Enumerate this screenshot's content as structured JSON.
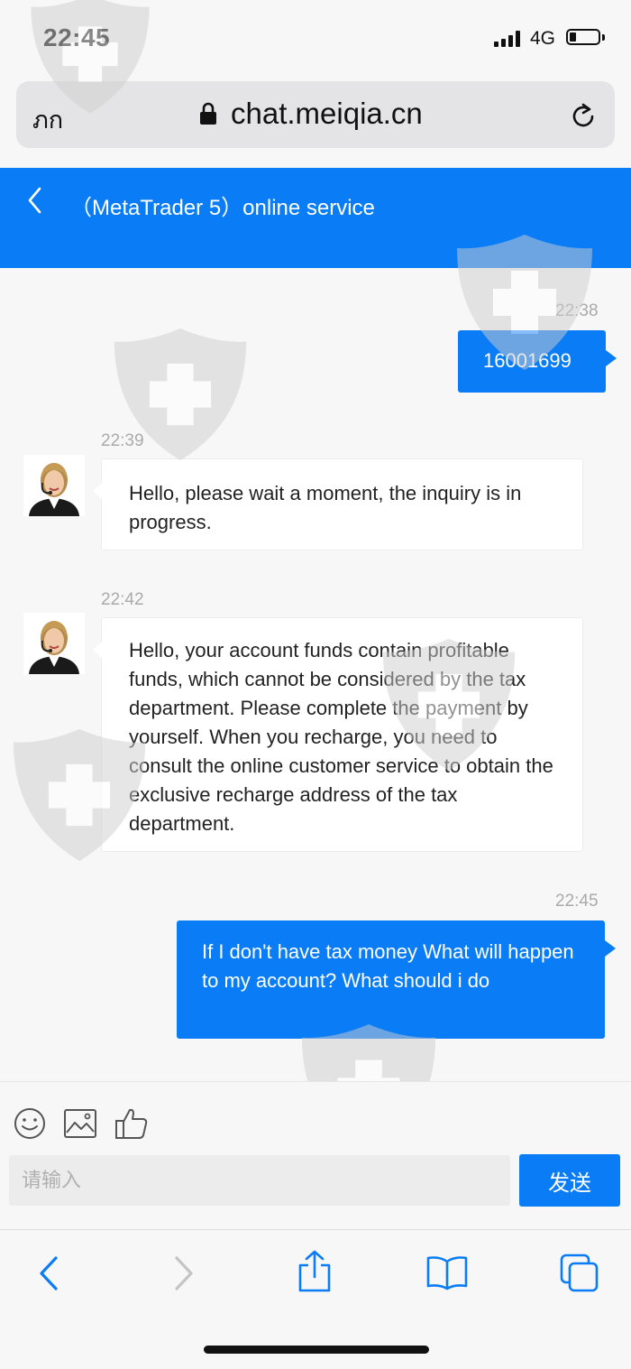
{
  "status_bar": {
    "time": "22:45",
    "network": "4G"
  },
  "browser": {
    "text_size_label": "ภก",
    "url": "chat.meiqia.cn"
  },
  "chat_header": {
    "title": "（MetaTrader 5）online service"
  },
  "messages": [
    {
      "side": "right",
      "time": "22:38",
      "text": "16001699"
    },
    {
      "side": "left",
      "time": "22:39",
      "text": "Hello, please wait a moment, the inquiry is in progress."
    },
    {
      "side": "left",
      "time": "22:42",
      "text": "Hello, your account funds contain profitable funds, which cannot be considered by the tax department. Please complete the payment by yourself. When you recharge, you need to consult the online customer service to obtain the exclusive recharge address of the tax department."
    },
    {
      "side": "right",
      "time": "22:45",
      "text": "If I don't have tax money What will happen to my account? What should i do"
    }
  ],
  "input": {
    "placeholder": "请输入",
    "value": ""
  },
  "send_button": {
    "label": "发送"
  },
  "colors": {
    "accent": "#0a7cf6",
    "background": "#f7f7f7"
  },
  "icons": [
    "emoji-icon",
    "image-icon",
    "thumbs-up-icon",
    "back-icon",
    "forward-icon",
    "share-icon",
    "bookmarks-icon",
    "tabs-icon"
  ]
}
